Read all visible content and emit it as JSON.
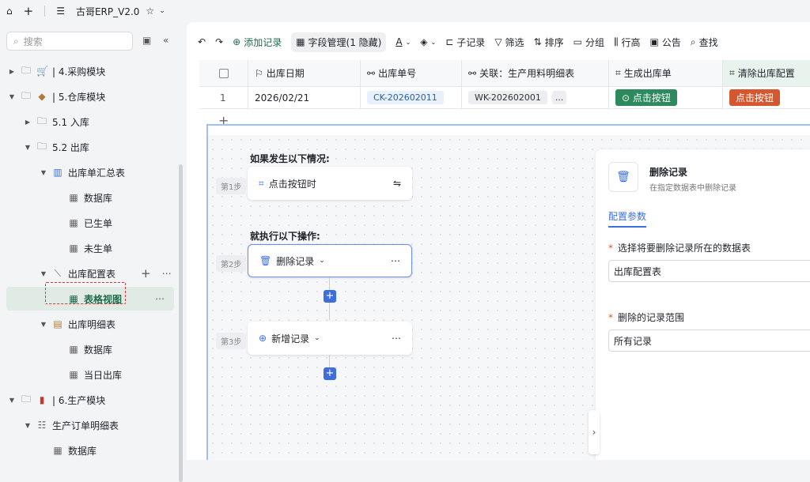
{
  "topbar": {
    "title": "古哥ERP_V2.0"
  },
  "sidebar": {
    "search_placeholder": "搜索",
    "items": [
      {
        "label": "| 4.采购模块"
      },
      {
        "label": "| 5.仓库模块"
      },
      {
        "label": "5.1 入库"
      },
      {
        "label": "5.2 出库"
      },
      {
        "label": "出库单汇总表"
      },
      {
        "label": "数据库"
      },
      {
        "label": "已生单"
      },
      {
        "label": "未生单"
      },
      {
        "label": "出库配置表"
      },
      {
        "label": "表格视图"
      },
      {
        "label": "出库明细表"
      },
      {
        "label": "数据库"
      },
      {
        "label": "当日出库"
      },
      {
        "label": "| 6.生产模块"
      },
      {
        "label": "生产订单明细表"
      },
      {
        "label": "数据库"
      }
    ]
  },
  "toolbar": {
    "add": "添加记录",
    "fields": "字段管理(1 隐藏)",
    "subrecord": "子记录",
    "filter": "筛选",
    "sort": "排序",
    "group": "分组",
    "rowheight": "行高",
    "notice": "公告",
    "find": "查找"
  },
  "table": {
    "headers": [
      "出库日期",
      "出库单号",
      "关联：生产用料明细表",
      "生成出库单",
      "清除出库配置"
    ],
    "row": {
      "index": "1",
      "date": "2026/02/21",
      "no": "CK-202602011",
      "link": "WK-202602001",
      "more": "...",
      "btn1": "点击按钮",
      "btn2": "点击按钮"
    }
  },
  "workflow": {
    "cond_label": "如果发生以下情况:",
    "action_label": "就执行以下操作:",
    "step1": "第1步",
    "step2": "第2步",
    "step3": "第3步",
    "trigger": "点击按钮时",
    "delete": "删除记录",
    "add": "新增记录"
  },
  "panel": {
    "title": "删除记录",
    "subtitle": "在指定数据表中删除记录",
    "tab": "配置参数",
    "q1": "选择将要删除记录所在的数据表",
    "a1": "出库配置表",
    "q2": "删除的记录范围",
    "a2": "所有记录"
  }
}
